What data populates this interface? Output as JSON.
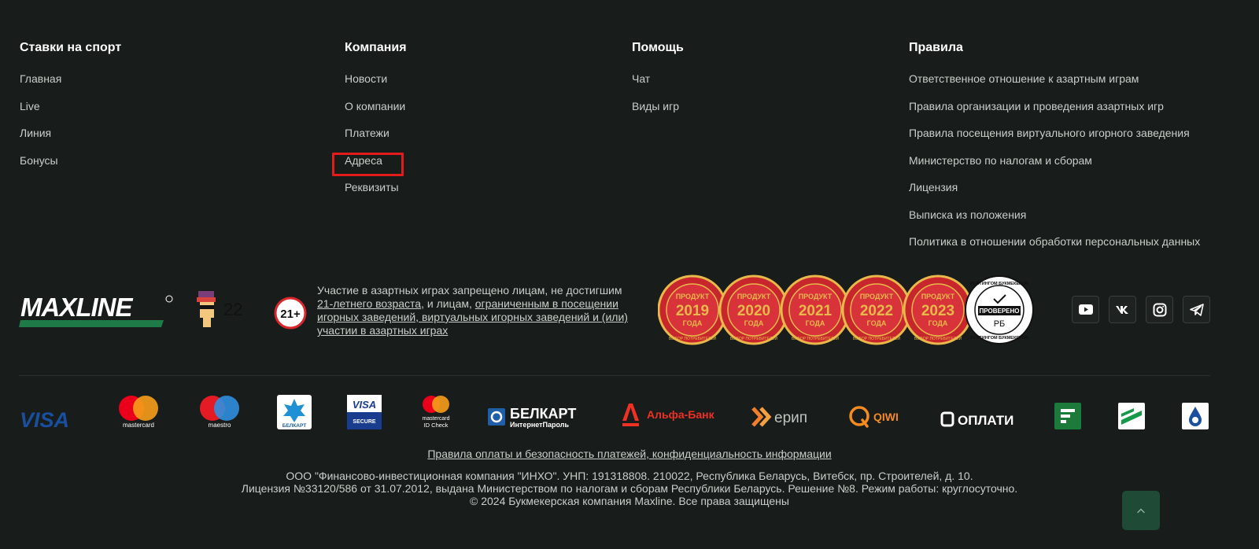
{
  "columns": [
    {
      "title": "Ставки на спорт",
      "links": [
        "Главная",
        "Live",
        "Линия",
        "Бонусы"
      ]
    },
    {
      "title": "Компания",
      "links": [
        "Новости",
        "О компании",
        "Платежи",
        "Адреса",
        "Реквизиты"
      ]
    },
    {
      "title": "Помощь",
      "links": [
        "Чат",
        "Виды игр"
      ]
    },
    {
      "title": "Правила",
      "links": [
        "Ответственное отношение к азартным играм",
        "Правила организации и проведения азартных игр",
        "Правила посещения виртуального игорного заведения",
        "Министерство по налогам и сборам",
        "Лицензия",
        "Выписка из положения",
        "Политика в отношении обработки персональных данных"
      ]
    }
  ],
  "brand": {
    "logo_text": "MAXLINE",
    "avatar_number": "22",
    "age_label": "21+"
  },
  "legal_notice": {
    "part1": "Участие в азартных играх запрещено лицам, не достигшим ",
    "link1": "21-летнего возраста",
    "part2": ", и лицам, ",
    "link2": "ограниченным в посещении игорных заведений, виртуальных игорных заведений и (или) участии в азартных играх"
  },
  "award_badges": [
    {
      "top": "ПРОДУКТ",
      "year": "2019",
      "bottom": "ГОДА",
      "ring": "ВЫБОР ПОТРЕБИТЕЛЕЙ"
    },
    {
      "top": "ПРОДУКТ",
      "year": "2020",
      "bottom": "ГОДА",
      "ring": "ВЫБОР ПОТРЕБИТЕЛЕЙ"
    },
    {
      "top": "ПРОДУКТ",
      "year": "2021",
      "bottom": "ГОДА",
      "ring": "ВЫБОР ПОТРЕБИТЕЛЕЙ"
    },
    {
      "top": "ПРОДУКТ",
      "year": "2022",
      "bottom": "ГОДА",
      "ring": "ВЫБОР ПОТРЕБИТЕЛЕЙ"
    },
    {
      "top": "ПРОДУКТ",
      "year": "2023",
      "bottom": "ГОДА",
      "ring": "ВЫБОР ПОТРЕБИТЕЛЕЙ"
    }
  ],
  "verified_badge": {
    "ring_top": "РЕЙТИНГОМ БУКМЕКЕРОВ",
    "label": "ПРОВЕРЕНО",
    "code": "РБ",
    "ring_bottom": "РЕЙТИНГОМ БУКМЕКЕРОВ"
  },
  "socials": [
    {
      "icon": "youtube-icon"
    },
    {
      "icon": "vk-icon"
    },
    {
      "icon": "instagram-icon"
    },
    {
      "icon": "telegram-icon"
    }
  ],
  "payments": {
    "visa": "VISA",
    "mastercard": "mastercard",
    "maestro": "maestro",
    "belkart_small": "БЕЛКАРТ",
    "visa_secure_top": "VISA",
    "visa_secure_bottom": "SECURE",
    "mc_idcheck_top": "mastercard",
    "mc_idcheck_bottom": "ID Check",
    "belkart_big": "БЕЛКАРТ",
    "belkart_big_sub": "ИнтернетПароль",
    "alfa": "Альфа-Банк",
    "erip": "ерип",
    "qiwi": "QIWI",
    "oplati": "ОПЛАТИ"
  },
  "footer": {
    "rules_link": "Правила оплаты и безопасность платежей, конфиденциальность информации",
    "line1": "ООО \"Финансово-инвестиционная компания \"ИНХО\". УНП: 191318808. 210022, Республика Беларусь, Витебск, пр. Строителей, д. 10.",
    "line2": "Лицензия №33120/586 от 31.07.2012, выдана Министерством по налогам и сборам Республики Беларусь. Решение №8. Режим работы: круглосуточно.",
    "line3": "© 2024 Букмекерская компания Maxline. Все права защищены"
  },
  "colors": {
    "background": "#181c1a",
    "accent_green": "#1e7a46",
    "highlight": "#e41b1b",
    "badge_red": "#c8262d",
    "badge_gold": "#e8b84a"
  }
}
